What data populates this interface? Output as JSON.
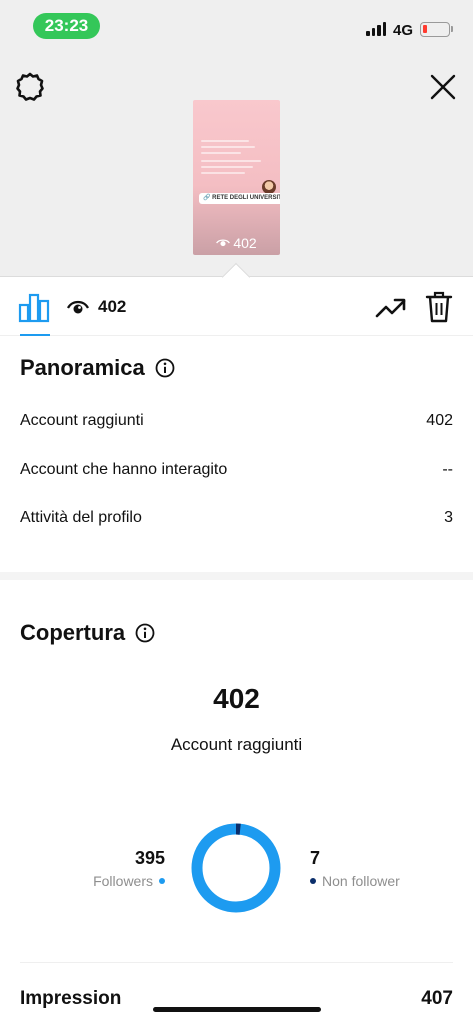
{
  "status_bar": {
    "time": "23:23",
    "network": "4G",
    "colors": {
      "time_pill": "#34c759",
      "battery_low": "#ff3b30"
    }
  },
  "story_preview": {
    "sticker_text": "🔗 RETE DEGLI UNIVERSITARI",
    "views": "402"
  },
  "toolbar": {
    "views": "402",
    "accent_color": "#1d9bf0"
  },
  "overview": {
    "title": "Panoramica",
    "rows": [
      {
        "label": "Account raggiunti",
        "value": "402"
      },
      {
        "label": "Account che hanno interagito",
        "value": "--"
      },
      {
        "label": "Attività del profilo",
        "value": "3"
      }
    ]
  },
  "reach": {
    "title": "Copertura",
    "total": "402",
    "total_label": "Account raggiunti",
    "followers": {
      "value": "395",
      "label": "Followers",
      "color": "#1d9bf0"
    },
    "non_followers": {
      "value": "7",
      "label": "Non follower",
      "color": "#0b2e6b"
    }
  },
  "impressions": {
    "label": "Impression",
    "value": "407"
  },
  "icons": [
    "settings-icon",
    "close-icon",
    "insights-bar-icon",
    "eye-icon",
    "trending-icon",
    "trash-icon",
    "info-icon"
  ]
}
